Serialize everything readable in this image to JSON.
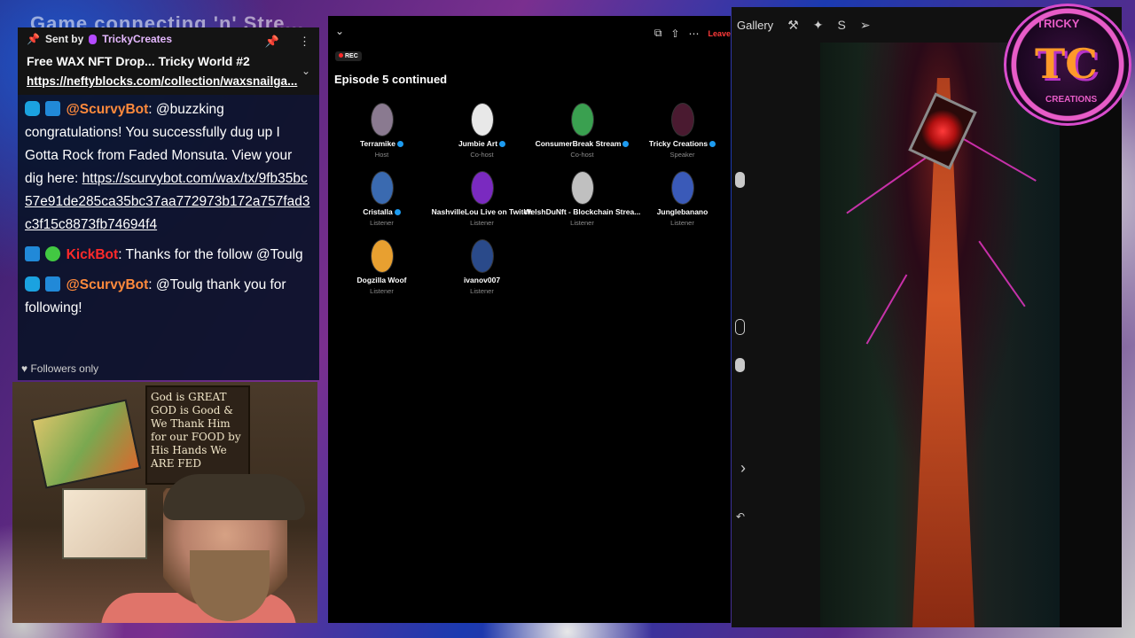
{
  "background": {
    "top_text": "Game connecting 'n' Stre..."
  },
  "chat": {
    "pinned": {
      "sent_label": "Sent by",
      "sender": "TrickyCreates",
      "title": "Free WAX NFT Drop... Tricky World #2",
      "link": "https://neftyblocks.com/collection/waxsnailga..."
    },
    "messages": [
      {
        "user": "@ScurvyBot",
        "text_parts": [
          ": @buzzking congratulations! You successfully dug up I Gotta Rock from Faded Monsuta. View your dig here: "
        ],
        "link": "https://scurvybot.com/wax/tx/9fb35bc57e91de285ca35bc37aa772973b172a757fad3c3f15c8873fb74694f4"
      },
      {
        "user": "KickBot",
        "text": ": Thanks for the follow @Toulg"
      },
      {
        "user": "@ScurvyBot",
        "text": ": @Toulg thank you for following!"
      }
    ],
    "followers_only": "Followers only"
  },
  "webcam": {
    "sign_text": "God is GREAT GOD is Good & We Thank Him for our FOOD by His Hands We ARE FED"
  },
  "space": {
    "rec_label": "REC",
    "leave_label": "Leave",
    "title": "Episode 5 continued",
    "participants": [
      {
        "name": "Terramike",
        "role": "Host",
        "verified": true,
        "color": "#8a7a90"
      },
      {
        "name": "Jumbie Art",
        "role": "Co-host",
        "verified": true,
        "color": "#e8e8e8"
      },
      {
        "name": "ConsumerBreak Stream",
        "role": "Co-host",
        "verified": true,
        "color": "#3aa050"
      },
      {
        "name": "Tricky Creations",
        "role": "Speaker",
        "verified": true,
        "color": "#4a1a30"
      },
      {
        "name": "Cristalla",
        "role": "Listener",
        "verified": true,
        "color": "#3a6ab0"
      },
      {
        "name": "NashvilleLou Live on Twitch",
        "role": "Listener",
        "verified": false,
        "color": "#7a2ac0"
      },
      {
        "name": "WelshDuNft - Blockchain Strea...",
        "role": "Listener",
        "verified": false,
        "color": "#c0c0c0"
      },
      {
        "name": "Junglebanano",
        "role": "Listener",
        "verified": false,
        "color": "#3a5ab8"
      },
      {
        "name": "Dogzilla Woof",
        "role": "Listener",
        "verified": false,
        "color": "#e8a030"
      },
      {
        "name": "ivanov007",
        "role": "Listener",
        "verified": false,
        "color": "#2a4a8a"
      }
    ]
  },
  "procreate": {
    "gallery_label": "Gallery"
  },
  "logo": {
    "mono": "TC",
    "top": "TRICKY",
    "bottom": "CREATIONS"
  }
}
